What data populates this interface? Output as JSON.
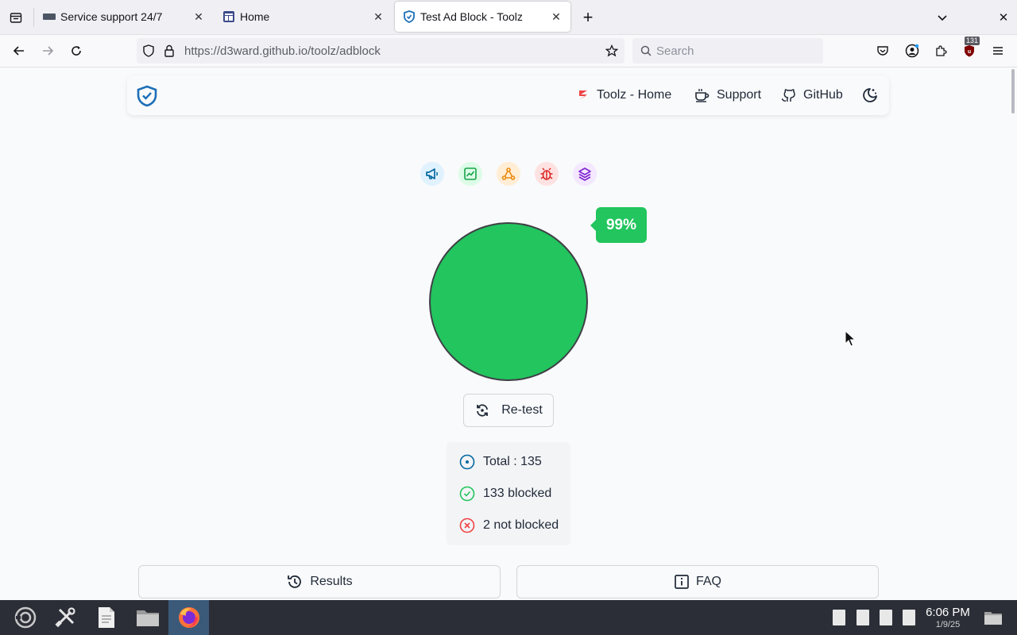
{
  "browser": {
    "tabs": [
      {
        "title": "Service support 24/7",
        "active": false
      },
      {
        "title": "Home",
        "active": false
      },
      {
        "title": "Test Ad Block - Toolz",
        "active": true
      }
    ],
    "url_host": "https://d3ward.github.io",
    "url_path": "/toolz/adblock",
    "search_placeholder": "Search",
    "extension_badge": "131"
  },
  "site": {
    "nav": {
      "home": "Toolz - Home",
      "support": "Support",
      "github": "GitHub"
    },
    "result": {
      "percent": "99%",
      "percent_value": 99,
      "retest_label": "Re-test",
      "total": "Total : 135",
      "blocked": "133 blocked",
      "not_blocked": "2 not blocked"
    },
    "buttons": {
      "results": "Results",
      "faq": "FAQ"
    },
    "colors": {
      "success": "#22c55e",
      "primary": "#0369a1",
      "danger": "#ef4444"
    }
  },
  "taskbar": {
    "time": "6:06 PM",
    "date": "1/9/25"
  }
}
